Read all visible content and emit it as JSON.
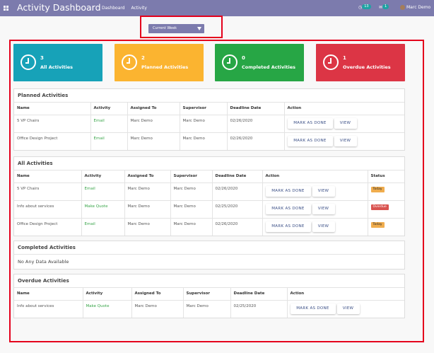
{
  "app": {
    "title": "Activity Dashboard",
    "menu": [
      "Dashboard",
      "Activity"
    ],
    "chat_count": "13",
    "message_count": "1",
    "user_name": "Marc Demo"
  },
  "filter": {
    "selected": "Current Week"
  },
  "cards": [
    {
      "count": "3",
      "label": "All Activities",
      "color": "#17a2b8"
    },
    {
      "count": "2",
      "label": "Planned Activities",
      "color": "#fbb430"
    },
    {
      "count": "0",
      "label": "Completed Activities",
      "color": "#27a645"
    },
    {
      "count": "1",
      "label": "Overdue Activities",
      "color": "#dc3545"
    }
  ],
  "buttons": {
    "done": "MARK AS DONE",
    "view": "VIEW"
  },
  "planned": {
    "title": "Planned Activities",
    "columns": [
      "Name",
      "Activity",
      "Assigned To",
      "Supervisor",
      "Deadline Date",
      "Action"
    ],
    "rows": [
      {
        "name": "5 VP Chairs",
        "activity": "Email",
        "assigned": "Marc Demo",
        "supervisor": "Marc Demo",
        "deadline": "02/26/2020"
      },
      {
        "name": "Office Design Project",
        "activity": "Email",
        "assigned": "Marc Demo",
        "supervisor": "Marc Demo",
        "deadline": "02/26/2020"
      }
    ]
  },
  "all": {
    "title": "All Activities",
    "columns": [
      "Name",
      "Activity",
      "Assigned To",
      "Supervisor",
      "Deadline Date",
      "Action",
      "Status"
    ],
    "rows": [
      {
        "name": "5 VP Chairs",
        "activity": "Email",
        "assigned": "Marc Demo",
        "supervisor": "Marc Demo",
        "deadline": "02/26/2020",
        "status": "Today"
      },
      {
        "name": "Info about services",
        "activity": "Make Quote",
        "assigned": "Marc Demo",
        "supervisor": "Marc Demo",
        "deadline": "02/25/2020",
        "status": "Overdue"
      },
      {
        "name": "Office Design Project",
        "activity": "Email",
        "assigned": "Marc Demo",
        "supervisor": "Marc Demo",
        "deadline": "02/26/2020",
        "status": "Today"
      }
    ]
  },
  "completed": {
    "title": "Completed Activities",
    "empty": "No Any Data Available"
  },
  "overdue": {
    "title": "Overdue Activities",
    "columns": [
      "Name",
      "Activity",
      "Assigned To",
      "Supervisor",
      "Deadline Date",
      "Action"
    ],
    "rows": [
      {
        "name": "Info about services",
        "activity": "Make Quote",
        "assigned": "Marc Demo",
        "supervisor": "Marc Demo",
        "deadline": "02/25/2020"
      }
    ]
  }
}
